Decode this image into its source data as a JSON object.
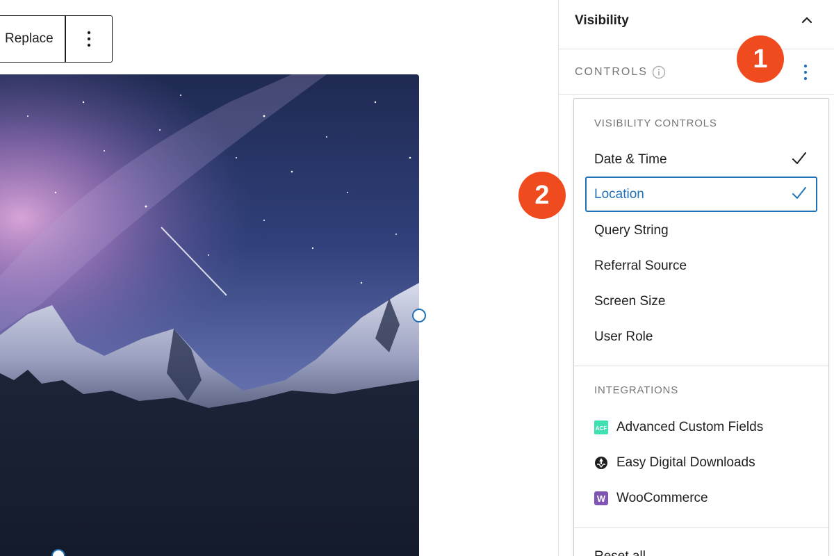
{
  "toolbar": {
    "replace_label": "Replace",
    "more_icon": "vertical-ellipsis-icon"
  },
  "image": {
    "description_icon": "mountain-night-sky"
  },
  "sidebar": {
    "panel_title": "Visibility",
    "toggle_icon": "chevron-up-icon",
    "controls_label": "CONTROLS",
    "info_icon": "info-icon",
    "menu_icon": "vertical-ellipsis-icon"
  },
  "dropdown": {
    "visibility_group_title": "VISIBILITY CONTROLS",
    "visibility_items": [
      {
        "label": "Date & Time",
        "checked": true
      },
      {
        "label": "Location",
        "checked": true,
        "selected": true
      },
      {
        "label": "Query String",
        "checked": false
      },
      {
        "label": "Referral Source",
        "checked": false
      },
      {
        "label": "Screen Size",
        "checked": false
      },
      {
        "label": "User Role",
        "checked": false
      }
    ],
    "integrations_group_title": "INTEGRATIONS",
    "integration_items": [
      {
        "label": "Advanced Custom Fields",
        "icon": "acf-icon",
        "icon_text": "ACF",
        "color": "#3fe0b1"
      },
      {
        "label": "Easy Digital Downloads",
        "icon": "edd-icon",
        "color": "#1e1e1e"
      },
      {
        "label": "WooCommerce",
        "icon": "woocommerce-icon",
        "icon_text": "W",
        "color": "#7f54b3"
      }
    ],
    "reset_label": "Reset all"
  },
  "badges": {
    "step1": "1",
    "step2": "2"
  },
  "colors": {
    "accent": "#1f72b8",
    "badge": "#f04a1f",
    "border": "#e0e0e0",
    "muted": "#757575"
  }
}
